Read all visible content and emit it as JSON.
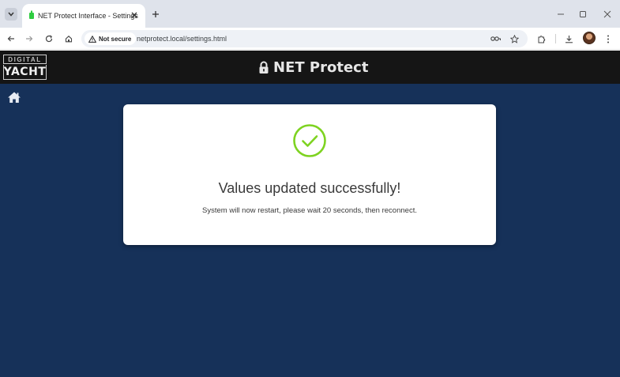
{
  "browser": {
    "tab_title": "NET Protect Interface - Settings",
    "security_label": "Not secure",
    "url": "netprotect.local/settings.html"
  },
  "app": {
    "logo_top": "DIGITAL",
    "logo_bottom": "YACHT",
    "brand_name": "NET Protect"
  },
  "dialog": {
    "title": "Values updated successfully!",
    "message": "System will now restart, please wait 20 seconds, then reconnect."
  },
  "colors": {
    "page_background": "#163159",
    "header_background": "#151515",
    "success_icon": "#7ed321"
  },
  "icons": [
    "tab-list-icon",
    "favicon-icon",
    "tab-close-icon",
    "new-tab-icon",
    "minimize-icon",
    "maximize-icon",
    "window-close-icon",
    "back-icon",
    "forward-icon",
    "reload-icon",
    "home-icon",
    "warning-icon",
    "password-key-icon",
    "star-icon",
    "extensions-icon",
    "download-icon",
    "kebab-menu-icon",
    "lock-icon",
    "house-icon",
    "check-circle-icon"
  ]
}
